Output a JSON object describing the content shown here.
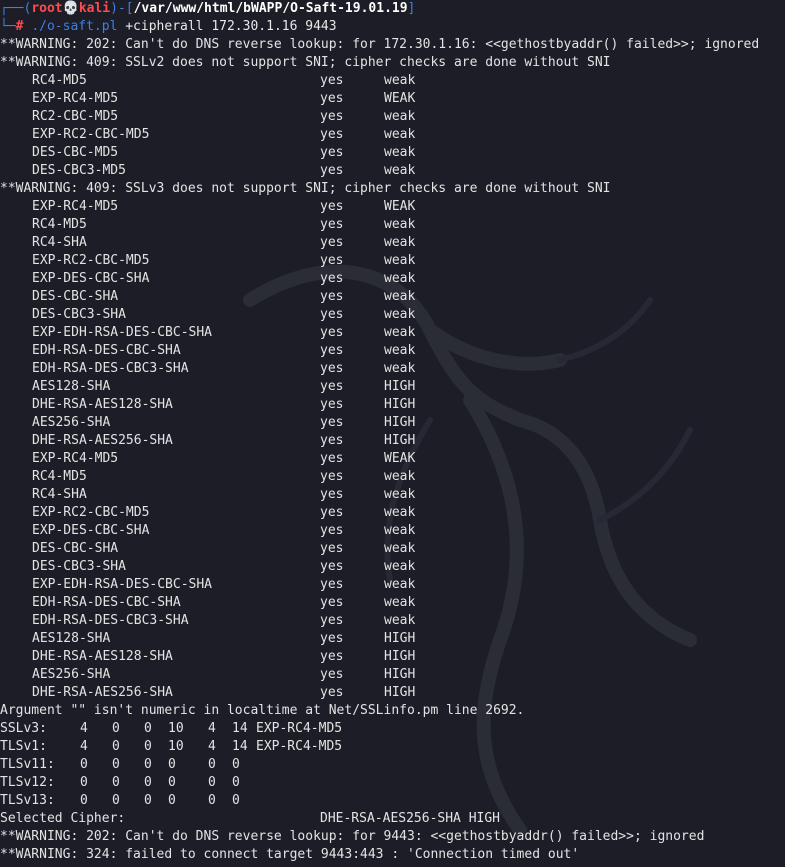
{
  "prompt": {
    "user": "root",
    "skull": "💀",
    "host": "kali",
    "path": "/var/www/html/bWAPP/O-Saft-19.01.19",
    "symbol": "#",
    "program": "./o-saft.pl",
    "args": "+cipherall 172.30.1.16 9443"
  },
  "warnings_top": [
    "**WARNING: 202: Can't do DNS reverse lookup: for 172.30.1.16: <<gethostbyaddr() failed>>; ignored",
    "**WARNING: 409: SSLv2 does not support SNI; cipher checks are done without SNI"
  ],
  "sslv2_rows": [
    {
      "cipher": "RC4-MD5",
      "supported": "yes",
      "grade": "weak"
    },
    {
      "cipher": "EXP-RC4-MD5",
      "supported": "yes",
      "grade": "WEAK"
    },
    {
      "cipher": "RC2-CBC-MD5",
      "supported": "yes",
      "grade": "weak"
    },
    {
      "cipher": "EXP-RC2-CBC-MD5",
      "supported": "yes",
      "grade": "weak"
    },
    {
      "cipher": "DES-CBC-MD5",
      "supported": "yes",
      "grade": "weak"
    },
    {
      "cipher": "DES-CBC3-MD5",
      "supported": "yes",
      "grade": "weak"
    }
  ],
  "warning_sslv3": "**WARNING: 409: SSLv3 does not support SNI; cipher checks are done without SNI",
  "sslv3_rows": [
    {
      "cipher": "EXP-RC4-MD5",
      "supported": "yes",
      "grade": "WEAK"
    },
    {
      "cipher": "RC4-MD5",
      "supported": "yes",
      "grade": "weak"
    },
    {
      "cipher": "RC4-SHA",
      "supported": "yes",
      "grade": "weak"
    },
    {
      "cipher": "EXP-RC2-CBC-MD5",
      "supported": "yes",
      "grade": "weak"
    },
    {
      "cipher": "EXP-DES-CBC-SHA",
      "supported": "yes",
      "grade": "weak"
    },
    {
      "cipher": "DES-CBC-SHA",
      "supported": "yes",
      "grade": "weak"
    },
    {
      "cipher": "DES-CBC3-SHA",
      "supported": "yes",
      "grade": "weak"
    },
    {
      "cipher": "EXP-EDH-RSA-DES-CBC-SHA",
      "supported": "yes",
      "grade": "weak"
    },
    {
      "cipher": "EDH-RSA-DES-CBC-SHA",
      "supported": "yes",
      "grade": "weak"
    },
    {
      "cipher": "EDH-RSA-DES-CBC3-SHA",
      "supported": "yes",
      "grade": "weak"
    },
    {
      "cipher": "AES128-SHA",
      "supported": "yes",
      "grade": "HIGH"
    },
    {
      "cipher": "DHE-RSA-AES128-SHA",
      "supported": "yes",
      "grade": "HIGH"
    },
    {
      "cipher": "AES256-SHA",
      "supported": "yes",
      "grade": "HIGH"
    },
    {
      "cipher": "DHE-RSA-AES256-SHA",
      "supported": "yes",
      "grade": "HIGH"
    },
    {
      "cipher": "EXP-RC4-MD5",
      "supported": "yes",
      "grade": "WEAK"
    },
    {
      "cipher": "RC4-MD5",
      "supported": "yes",
      "grade": "weak"
    },
    {
      "cipher": "RC4-SHA",
      "supported": "yes",
      "grade": "weak"
    },
    {
      "cipher": "EXP-RC2-CBC-MD5",
      "supported": "yes",
      "grade": "weak"
    },
    {
      "cipher": "EXP-DES-CBC-SHA",
      "supported": "yes",
      "grade": "weak"
    },
    {
      "cipher": "DES-CBC-SHA",
      "supported": "yes",
      "grade": "weak"
    },
    {
      "cipher": "DES-CBC3-SHA",
      "supported": "yes",
      "grade": "weak"
    },
    {
      "cipher": "EXP-EDH-RSA-DES-CBC-SHA",
      "supported": "yes",
      "grade": "weak"
    },
    {
      "cipher": "EDH-RSA-DES-CBC-SHA",
      "supported": "yes",
      "grade": "weak"
    },
    {
      "cipher": "EDH-RSA-DES-CBC3-SHA",
      "supported": "yes",
      "grade": "weak"
    },
    {
      "cipher": "AES128-SHA",
      "supported": "yes",
      "grade": "HIGH"
    },
    {
      "cipher": "DHE-RSA-AES128-SHA",
      "supported": "yes",
      "grade": "HIGH"
    },
    {
      "cipher": "AES256-SHA",
      "supported": "yes",
      "grade": "HIGH"
    },
    {
      "cipher": "DHE-RSA-AES256-SHA",
      "supported": "yes",
      "grade": "HIGH"
    }
  ],
  "argument_warning": "Argument \"\" isn't numeric in localtime at Net/SSLinfo.pm line 2692.",
  "summary": [
    {
      "label": "SSLv3:",
      "v": [
        "4",
        "0",
        "0",
        "10",
        "4",
        "14"
      ],
      "cipher": "EXP-RC4-MD5"
    },
    {
      "label": "TLSv1:",
      "v": [
        "4",
        "0",
        "0",
        "10",
        "4",
        "14"
      ],
      "cipher": "EXP-RC4-MD5"
    },
    {
      "label": "TLSv11:",
      "v": [
        "0",
        "0",
        "0",
        "0",
        "0",
        "0"
      ],
      "cipher": ""
    },
    {
      "label": "TLSv12:",
      "v": [
        "0",
        "0",
        "0",
        "0",
        "0",
        "0"
      ],
      "cipher": ""
    },
    {
      "label": "TLSv13:",
      "v": [
        "0",
        "0",
        "0",
        "0",
        "0",
        "0"
      ],
      "cipher": ""
    }
  ],
  "selected": {
    "label": "Selected Cipher:",
    "value": "DHE-RSA-AES256-SHA HIGH"
  },
  "warnings_bottom": [
    "**WARNING: 202: Can't do DNS reverse lookup: for 9443: <<gethostbyaddr() failed>>; ignored",
    "**WARNING: 324: failed to connect target 9443:443 : 'Connection timed out'"
  ],
  "colors": {
    "background": "#1c1d26",
    "prompt_blue": "#3d7fe6",
    "prompt_red": "#ff4b4b",
    "text": "#e3e3e3"
  }
}
